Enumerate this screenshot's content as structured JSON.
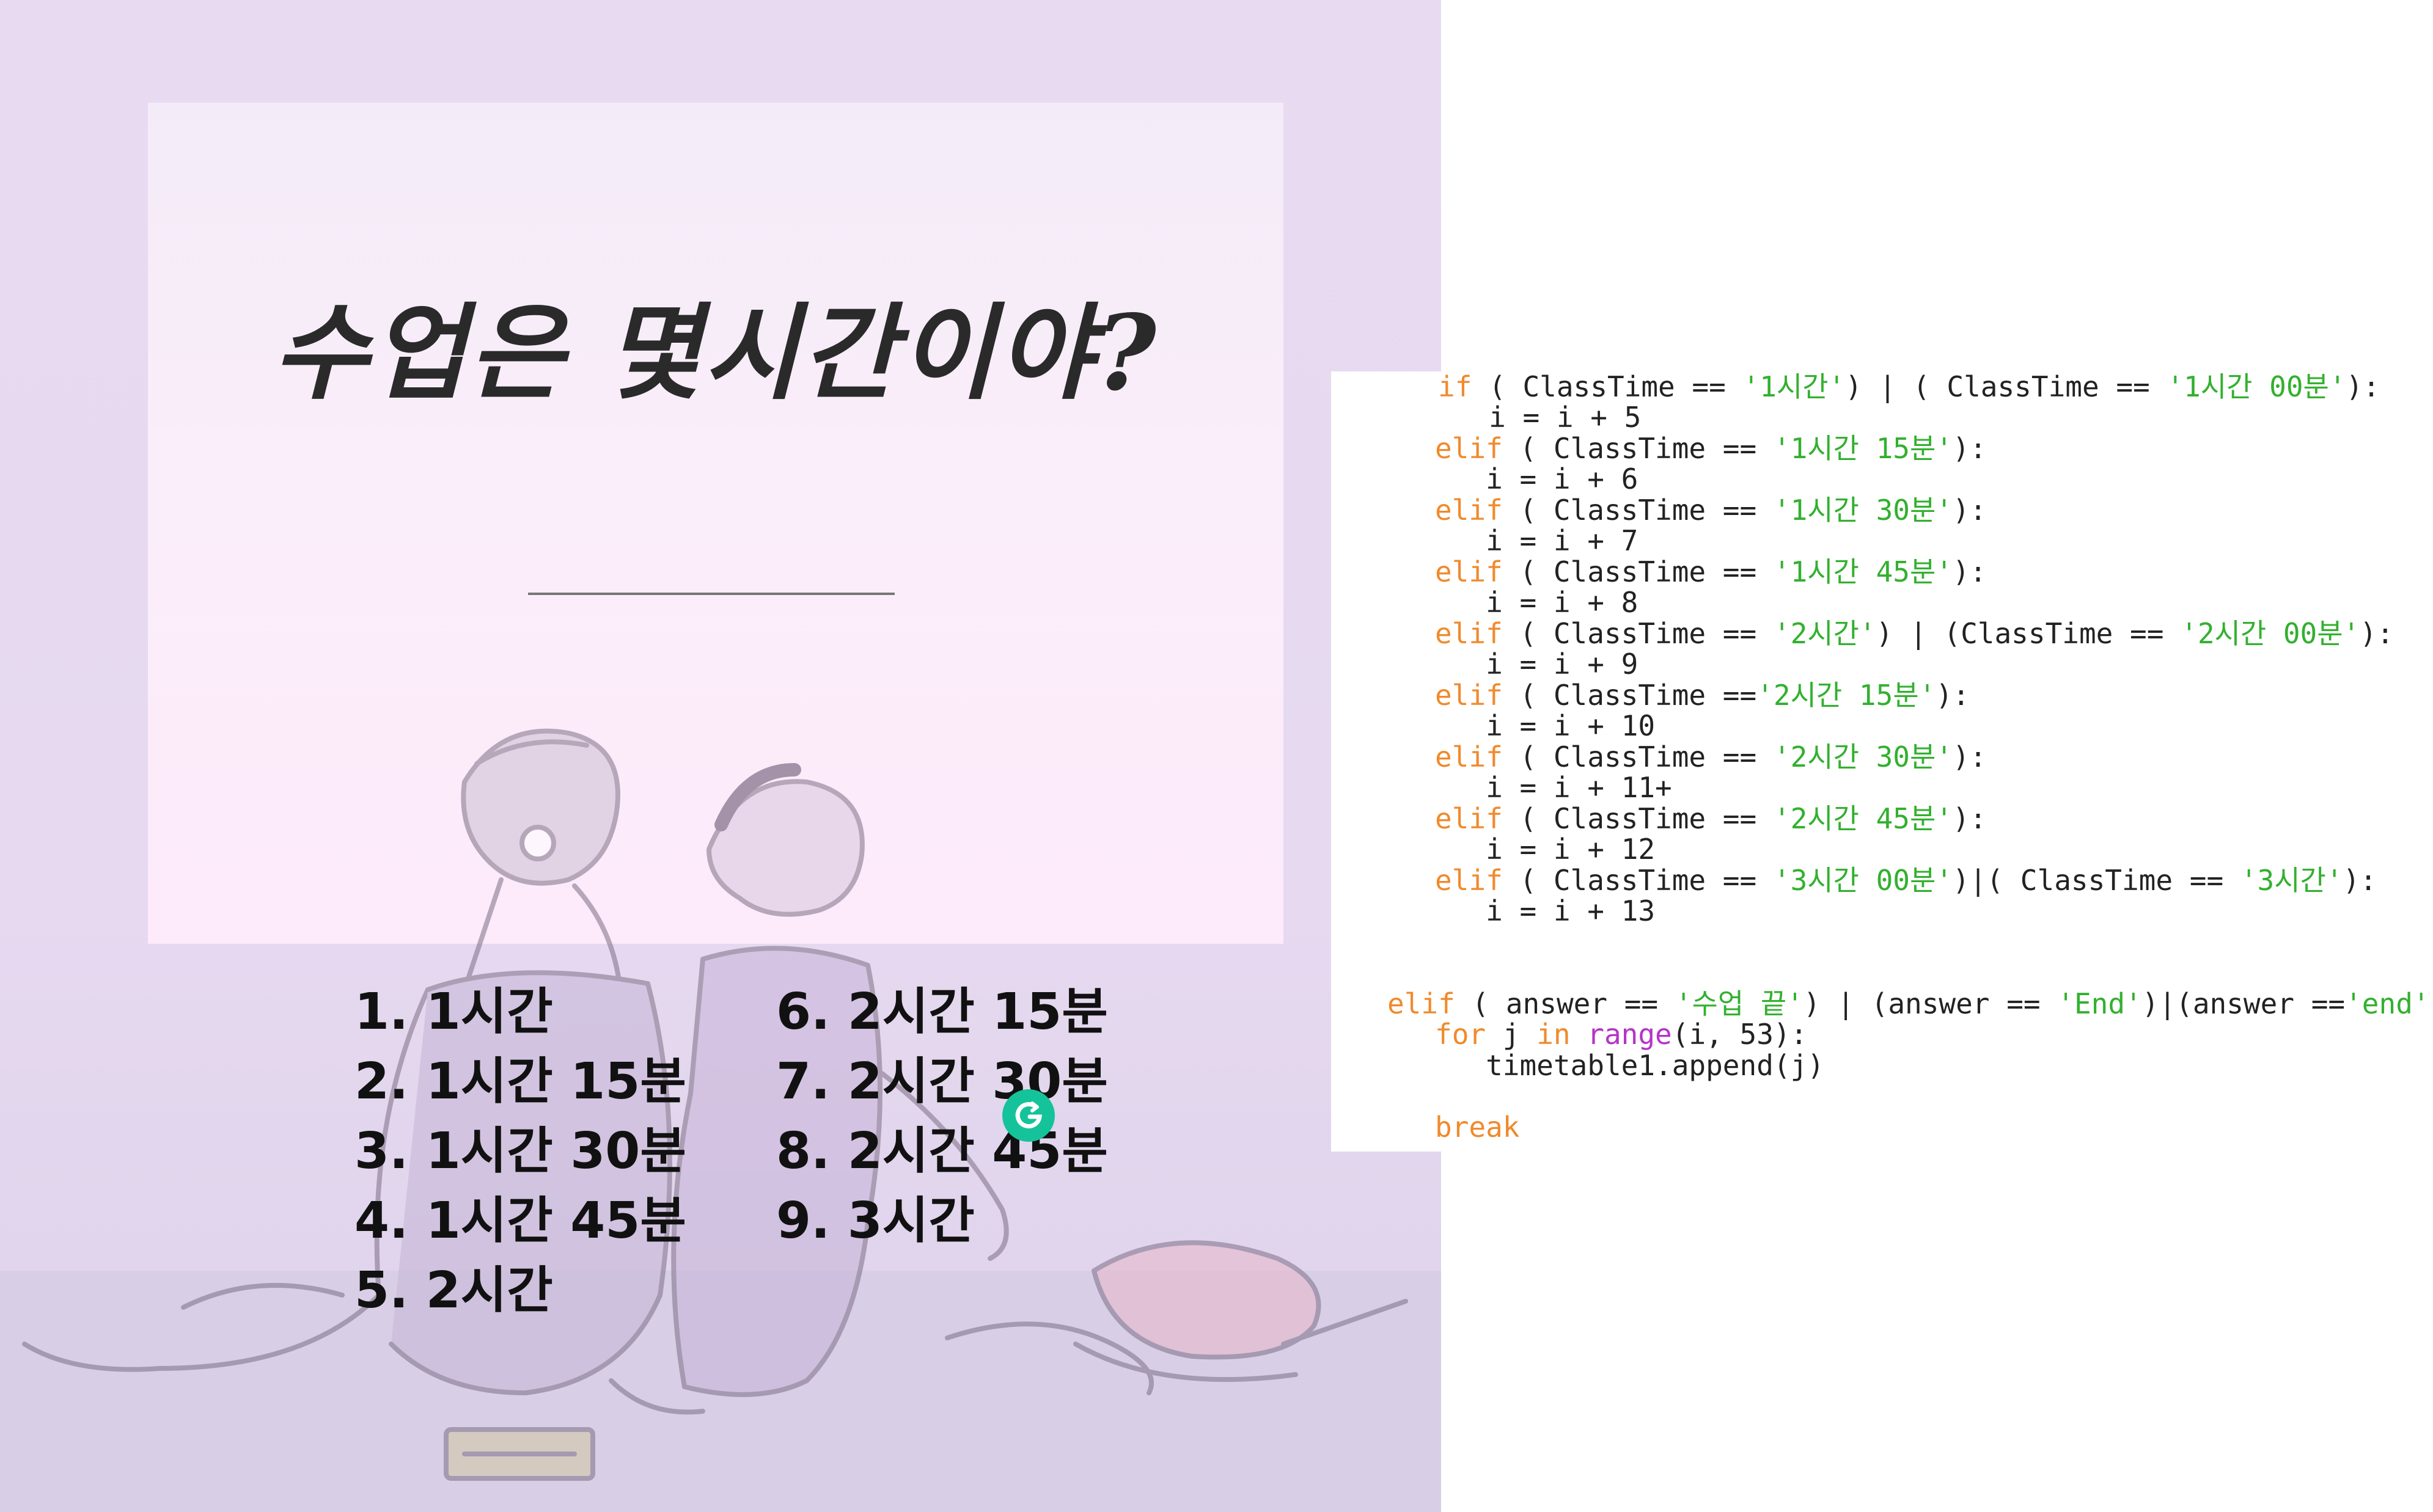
{
  "slide": {
    "title": "수업은 몇시간이야?",
    "options_left": [
      "1. 1시간",
      "2. 1시간 15분",
      "3. 1시간 30분",
      "4. 1시간 45분",
      "5. 2시간"
    ],
    "options_right": [
      "6. 2시간 15분",
      "7. 2시간 30분",
      "8. 2시간 45분",
      "9. 3시간"
    ]
  },
  "code": {
    "l1": {
      "kw": "if",
      "p1": " ( ClassTime == ",
      "s1": "'1시간'",
      "p2": ") | ( ClassTime == ",
      "s2": "'1시간 00분'",
      "p3": "):"
    },
    "l2": "   i = i + 5",
    "l3": {
      "kw": "elif",
      "p1": " ( ClassTime == ",
      "s1": "'1시간 15분'",
      "p2": "):"
    },
    "l4": "   i = i + 6",
    "l5": {
      "kw": "elif",
      "p1": " ( ClassTime == ",
      "s1": "'1시간 30분'",
      "p2": "):"
    },
    "l6": "   i = i + 7",
    "l7": {
      "kw": "elif",
      "p1": " ( ClassTime == ",
      "s1": "'1시간 45분'",
      "p2": "):"
    },
    "l8": "   i = i + 8",
    "l9": {
      "kw": "elif",
      "p1": " ( ClassTime == ",
      "s1": "'2시간'",
      "p2": ") | (ClassTime == ",
      "s2": "'2시간 00분'",
      "p3": "):"
    },
    "l10": "   i = i + 9",
    "l11": {
      "kw": "elif",
      "p1": " ( ClassTime ==",
      "s1": "'2시간 15분'",
      "p2": "):"
    },
    "l12": "   i = i + 10",
    "l13": {
      "kw": "elif",
      "p1": " ( ClassTime == ",
      "s1": "'2시간 30분'",
      "p2": "):"
    },
    "l14": "   i = i + 11+",
    "l15": {
      "kw": "elif",
      "p1": " ( ClassTime == ",
      "s1": "'2시간 45분'",
      "p2": "):"
    },
    "l16": "   i = i + 12",
    "l17": {
      "kw": "elif",
      "p1": " ( ClassTime == ",
      "s1": "'3시간 00분'",
      "p2": ")|( ClassTime == ",
      "s2": "'3시간'",
      "p3": "):"
    },
    "l18": "   i = i + 13",
    "l19": {
      "kw": "elif",
      "p1": " ( answer == ",
      "s1": "'수업 끝'",
      "p2": ") | (answer == ",
      "s2": "'End'",
      "p3": ")|(answer ==",
      "s3": "'end'",
      "p4": ")"
    },
    "l20": {
      "kw1": "for",
      "p1": " j ",
      "kw2": "in",
      "p2": " ",
      "bi": "range",
      "p3": "(i, 53):"
    },
    "l21": "   timetable1.append(j)",
    "l22": {
      "kw": "break"
    }
  },
  "colors": {
    "keyword": "#f08a2c",
    "string": "#33b02f",
    "builtin": "#b534c8",
    "grammarly": "#15c39a"
  }
}
